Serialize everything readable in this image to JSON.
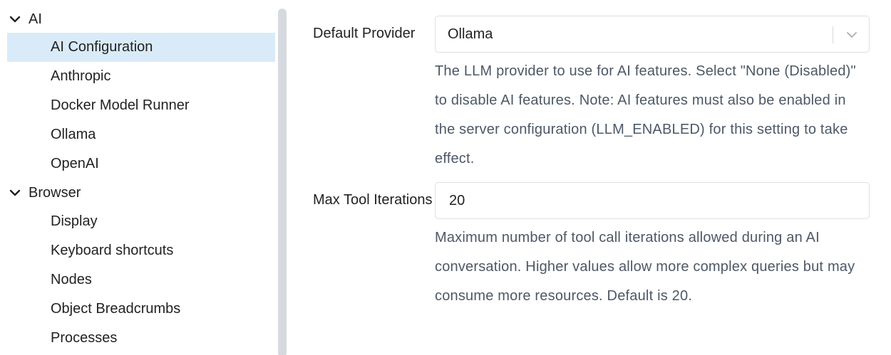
{
  "sidebar": {
    "groups": [
      {
        "label": "AI",
        "items": [
          {
            "label": "AI Configuration",
            "selected": true
          },
          {
            "label": "Anthropic"
          },
          {
            "label": "Docker Model Runner"
          },
          {
            "label": "Ollama"
          },
          {
            "label": "OpenAI"
          }
        ]
      },
      {
        "label": "Browser",
        "items": [
          {
            "label": "Display"
          },
          {
            "label": "Keyboard shortcuts"
          },
          {
            "label": "Nodes"
          },
          {
            "label": "Object Breadcrumbs"
          },
          {
            "label": "Processes"
          }
        ]
      }
    ]
  },
  "settings": {
    "default_provider": {
      "label": "Default Provider",
      "value": "Ollama",
      "help": "The LLM provider to use for AI features. Select \"None (Disabled)\" to disable AI features. Note: AI features must also be enabled in the server configuration (LLM_ENABLED) for this setting to take effect."
    },
    "max_tool_iterations": {
      "label": "Max Tool Iterations",
      "value": "20",
      "help": "Maximum number of tool call iterations allowed during an AI conversation. Higher values allow more complex queries but may consume more resources. Default is 20."
    }
  },
  "icons": {
    "group_expand": "chevron-down-icon",
    "select_dropdown": "chevron-down-icon"
  },
  "colors": {
    "selected_bg": "#d9ebf8",
    "help_text": "#4d5867",
    "border": "#dcdfe4",
    "splitter": "#d6d9de"
  }
}
